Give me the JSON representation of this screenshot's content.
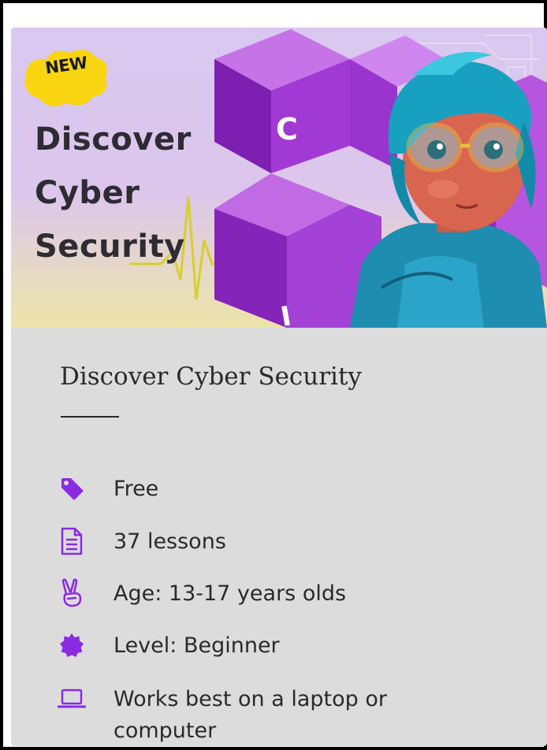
{
  "banner": {
    "badge": "NEW",
    "title_lines": [
      "Discover",
      "Cyber",
      "Security"
    ],
    "cube_letters": [
      "C",
      "I"
    ],
    "colors": {
      "badge_yellow": "#f9d511",
      "cube_purple": "#9b2fc6",
      "character_hair": "#1aa6c8"
    }
  },
  "course": {
    "title": "Discover Cyber Security",
    "features": [
      {
        "icon": "price-tag-icon",
        "text": "Free"
      },
      {
        "icon": "document-icon",
        "text": "37 lessons"
      },
      {
        "icon": "peace-hand-icon",
        "text": "Age: 13-17 years olds"
      },
      {
        "icon": "badge-icon",
        "text": "Level: Beginner"
      },
      {
        "icon": "laptop-icon",
        "text": "Works best on a laptop or computer"
      }
    ],
    "accent_color": "#8a2be2"
  }
}
